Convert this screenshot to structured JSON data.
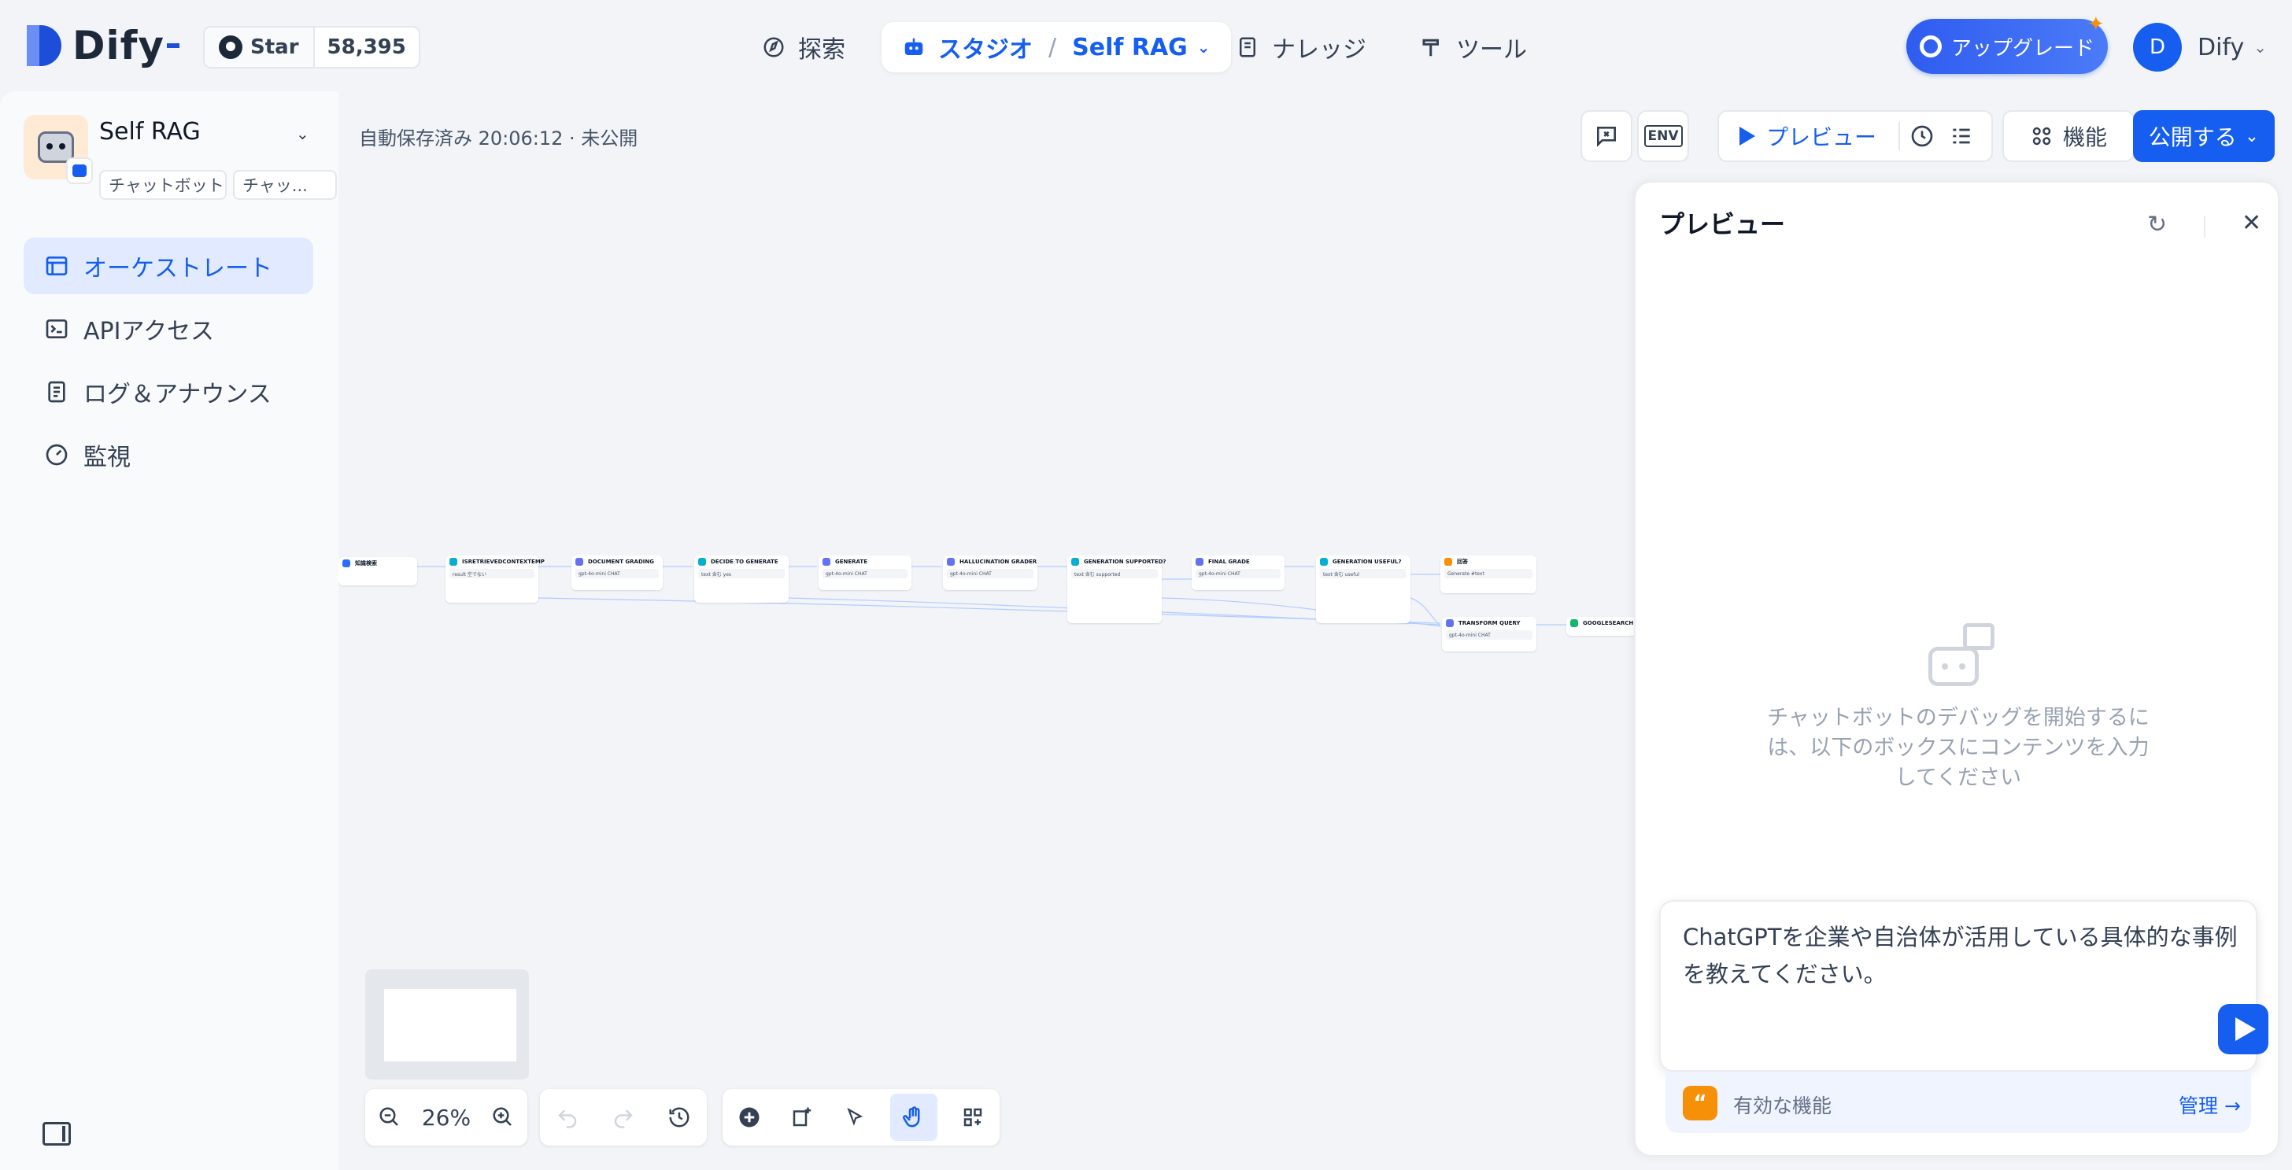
{
  "header": {
    "logo_text": "Dify",
    "github": {
      "star_label": "Star",
      "star_count": "58,395"
    },
    "nav": {
      "explore": "探索",
      "studio": "スタジオ",
      "studio_sep": "/",
      "app_name": "Self RAG",
      "knowledge": "ナレッジ",
      "tools": "ツール"
    },
    "upgrade_label": "アップグレード",
    "user": {
      "initial": "D",
      "name": "Dify"
    }
  },
  "sidebar": {
    "app": {
      "name": "Self RAG",
      "tag1": "チャットボット",
      "tag2": "チャッ..."
    },
    "items": [
      {
        "label": "オーケストレート",
        "icon": "layout-icon",
        "active": true
      },
      {
        "label": "APIアクセス",
        "icon": "terminal-icon",
        "active": false
      },
      {
        "label": "ログ＆アナウンス",
        "icon": "file-list-icon",
        "active": false
      },
      {
        "label": "監視",
        "icon": "gauge-icon",
        "active": false
      }
    ]
  },
  "workflow": {
    "autosave": "自動保存済み 20:06:12 · 未公開",
    "toolbar": {
      "env": "ENV",
      "preview": "プレビュー",
      "features": "機能",
      "publish": "公開する"
    },
    "zoom": "26%",
    "nodes": [
      {
        "title": "知識検索",
        "row": ""
      },
      {
        "title": "ISRETRIEVEDCONTEXTEMP",
        "row": "result 空でない"
      },
      {
        "title": "DOCUMENT GRADING",
        "row": "gpt-4o-mini  CHAT"
      },
      {
        "title": "DECIDE TO GENERATE",
        "row": "text 含む yes"
      },
      {
        "title": "GENERATE",
        "row": "gpt-4o-mini  CHAT"
      },
      {
        "title": "HALLUCINATION GRADER",
        "row": "gpt-4o-mini  CHAT"
      },
      {
        "title": "GENERATION SUPPORTED?",
        "row": "text 含む supported"
      },
      {
        "title": "FINAL GRADE",
        "row": "gpt-4o-mini  CHAT"
      },
      {
        "title": "GENERATION USEFUL?",
        "row": "text 含む useful"
      },
      {
        "title": "回答",
        "row": "Generate  #text"
      },
      {
        "title": "TRANSFORM QUERY",
        "row": "gpt-4o-mini  CHAT"
      },
      {
        "title": "GOOGLESEARCH",
        "row": ""
      }
    ]
  },
  "preview": {
    "title": "プレビュー",
    "empty_text": "チャットボットのデバッグを開始するには、以下のボックスにコンテンツを入力してください",
    "input_value": "ChatGPTを企業や自治体が活用している具体的な事例を教えてください。",
    "features_label": "有効な機能",
    "manage_label": "管理 →"
  },
  "colors": {
    "accent": "#155eef",
    "active_bg": "#e1eaff",
    "feature_orange": "#f79009"
  }
}
